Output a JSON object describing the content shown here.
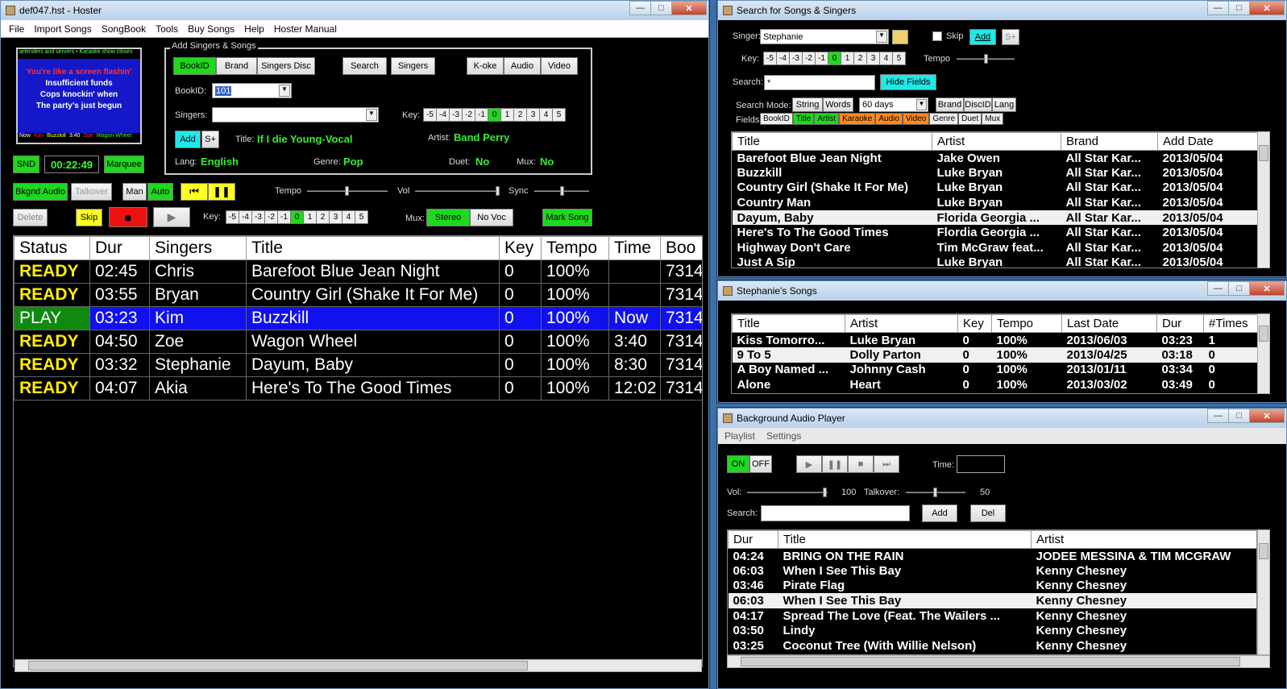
{
  "hoster": {
    "title": "def047.hst - Hoster",
    "menu": [
      "File",
      "Import Songs",
      "SongBook",
      "Tools",
      "Buy Songs",
      "Help",
      "Hoster Manual"
    ],
    "marquee": {
      "top": "artenders and servers • Karaoke show closes",
      "lines": [
        "You're like a screen flashin'",
        "Insufficient funds",
        "Cops knockin' when",
        "The party's just begun"
      ],
      "now": "Now",
      "now_singer": "Kim",
      "now_song": "Buzzkill",
      "next_time": "3:40",
      "next_singer": "Zoe",
      "next_song": "Wagon Wheel"
    },
    "snd": "SND",
    "clock": "00:22:49",
    "marquee_btn": "Marquee",
    "group_label": "Add Singers & Songs",
    "tabs": [
      "BookID",
      "Brand",
      "Singers Disc"
    ],
    "search": "Search",
    "singers_btn": "Singers",
    "koke": "K-oke",
    "audio": "Audio",
    "video": "Video",
    "bookid_label": "BookID:",
    "bookid_value": "101",
    "singers_label": "Singers:",
    "key_label": "Key:",
    "keys": [
      "-5",
      "-4",
      "-3",
      "-2",
      "-1",
      "0",
      "1",
      "2",
      "3",
      "4",
      "5"
    ],
    "add": "Add",
    "splus": "S+",
    "title_label": "Title:",
    "title_value": "If I die Young-Vocal",
    "artist_label": "Artist:",
    "artist_value": "Band Perry",
    "lang_label": "Lang:",
    "lang_value": "English",
    "genre_label": "Genre:",
    "genre_value": "Pop",
    "duet_label": "Duet:",
    "duet_value": "No",
    "mux_label": "Mux:",
    "mux_value": "No",
    "bkgnd": "Bkgnd Audio",
    "talkover": "Talkover",
    "man": "Man",
    "auto": "Auto",
    "tempo": "Tempo",
    "vol": "Vol",
    "sync": "Sync",
    "delete": "Delete",
    "skip": "Skip",
    "key2": "Key:",
    "mux2": "Mux:",
    "stereo": "Stereo",
    "novoc": "No Voc",
    "mark": "Mark Song",
    "columns": [
      "Status",
      "Dur",
      "Singers",
      "Title",
      "Key",
      "Tempo",
      "Time",
      "Boo"
    ],
    "rows": [
      {
        "status": "READY",
        "dur": "02:45",
        "singer": "Chris",
        "title": "Barefoot Blue Jean Night",
        "key": "0",
        "tempo": "100%",
        "time": "",
        "book": "7314"
      },
      {
        "status": "READY",
        "dur": "03:55",
        "singer": "Bryan",
        "title": "Country Girl (Shake It For Me)",
        "key": "0",
        "tempo": "100%",
        "time": "",
        "book": "7314"
      },
      {
        "status": "PLAY",
        "dur": "03:23",
        "singer": "Kim",
        "title": "Buzzkill",
        "key": "0",
        "tempo": "100%",
        "time": "Now",
        "book": "7314"
      },
      {
        "status": "READY",
        "dur": "04:50",
        "singer": "Zoe",
        "title": "Wagon Wheel",
        "key": "0",
        "tempo": "100%",
        "time": "3:40",
        "book": "7314"
      },
      {
        "status": "READY",
        "dur": "03:32",
        "singer": "Stephanie",
        "title": "Dayum, Baby",
        "key": "0",
        "tempo": "100%",
        "time": "8:30",
        "book": "7314"
      },
      {
        "status": "READY",
        "dur": "04:07",
        "singer": "Akia",
        "title": "Here's To The Good Times",
        "key": "0",
        "tempo": "100%",
        "time": "12:02",
        "book": "7314"
      }
    ]
  },
  "search": {
    "title": "Search for Songs & Singers",
    "singer_label": "Singer:",
    "singer_value": "Stephanie",
    "skip": "Skip",
    "add": "Add",
    "splus": "S+",
    "key_label": "Key:",
    "tempo_label": "Tempo",
    "search_label": "Search:",
    "search_value": "*",
    "hide": "Hide Fields",
    "mode_label": "Search Mode:",
    "string": "String",
    "words": "Words",
    "days": "60 days",
    "brand": "Brand",
    "discid": "DiscID",
    "lang": "Lang",
    "fields_label": "Fields:",
    "fields": [
      "BookID",
      "Title",
      "Artist",
      "Karaoke",
      "Audio",
      "Video",
      "Genre",
      "Duet",
      "Mux"
    ],
    "columns": [
      "Title",
      "Artist",
      "Brand",
      "Add Date"
    ],
    "rows": [
      [
        "Barefoot Blue Jean Night",
        "Jake Owen",
        "All Star Kar...",
        "2013/05/04"
      ],
      [
        "Buzzkill",
        "Luke Bryan",
        "All Star Kar...",
        "2013/05/04"
      ],
      [
        "Country Girl (Shake It For Me)",
        "Luke Bryan",
        "All Star Kar...",
        "2013/05/04"
      ],
      [
        "Country Man",
        "Luke Bryan",
        "All Star Kar...",
        "2013/05/04"
      ],
      [
        "Dayum, Baby",
        "Florida Georgia ...",
        "All Star Kar...",
        "2013/05/04"
      ],
      [
        "Here's To The Good Times",
        "Flordia Georgia ...",
        "All Star Kar...",
        "2013/05/04"
      ],
      [
        "Highway Don't Care",
        "Tim McGraw feat...",
        "All Star Kar...",
        "2013/05/04"
      ],
      [
        "Just A Sip",
        "Luke Bryan",
        "All Star Kar...",
        "2013/05/04"
      ]
    ]
  },
  "steph": {
    "title": "Stephanie's Songs",
    "columns": [
      "Title",
      "Artist",
      "Key",
      "Tempo",
      "Last Date",
      "Dur",
      "#Times"
    ],
    "rows": [
      [
        " Kiss Tomorro...",
        "Luke Bryan",
        "0",
        "100%",
        "2013/06/03",
        "03:23",
        "1"
      ],
      [
        "9 To 5",
        "Dolly Parton",
        "0",
        "100%",
        "2013/04/25",
        "03:18",
        "0"
      ],
      [
        "A Boy Named ...",
        "Johnny Cash",
        "0",
        "100%",
        "2013/01/11",
        "03:34",
        "0"
      ],
      [
        "Alone",
        "Heart",
        "0",
        "100%",
        "2013/03/02",
        "03:49",
        "0"
      ]
    ]
  },
  "bap": {
    "title": "Background Audio Player",
    "menu": [
      "Playlist",
      "Settings"
    ],
    "on": "ON",
    "off": "OFF",
    "time_label": "Time:",
    "vol_label": "Vol:",
    "vol_value": "100",
    "talk_label": "Talkover:",
    "talk_value": "50",
    "search_label": "Search:",
    "add": "Add",
    "del": "Del",
    "columns": [
      "Dur",
      "Title",
      "Artist"
    ],
    "rows": [
      [
        "04:24",
        "BRING ON THE RAIN",
        "JODEE MESSINA & TIM MCGRAW"
      ],
      [
        "06:03",
        "When I See This Bay",
        "Kenny Chesney"
      ],
      [
        "03:46",
        "Pirate Flag",
        "Kenny Chesney"
      ],
      [
        "06:03",
        "When I See This Bay",
        "Kenny Chesney"
      ],
      [
        "04:17",
        "Spread The Love (Feat. The Wailers ...",
        "Kenny Chesney"
      ],
      [
        "03:50",
        "Lindy",
        "Kenny Chesney"
      ],
      [
        "03:25",
        "Coconut Tree (With Willie Nelson)",
        "Kenny Chesney"
      ]
    ]
  }
}
